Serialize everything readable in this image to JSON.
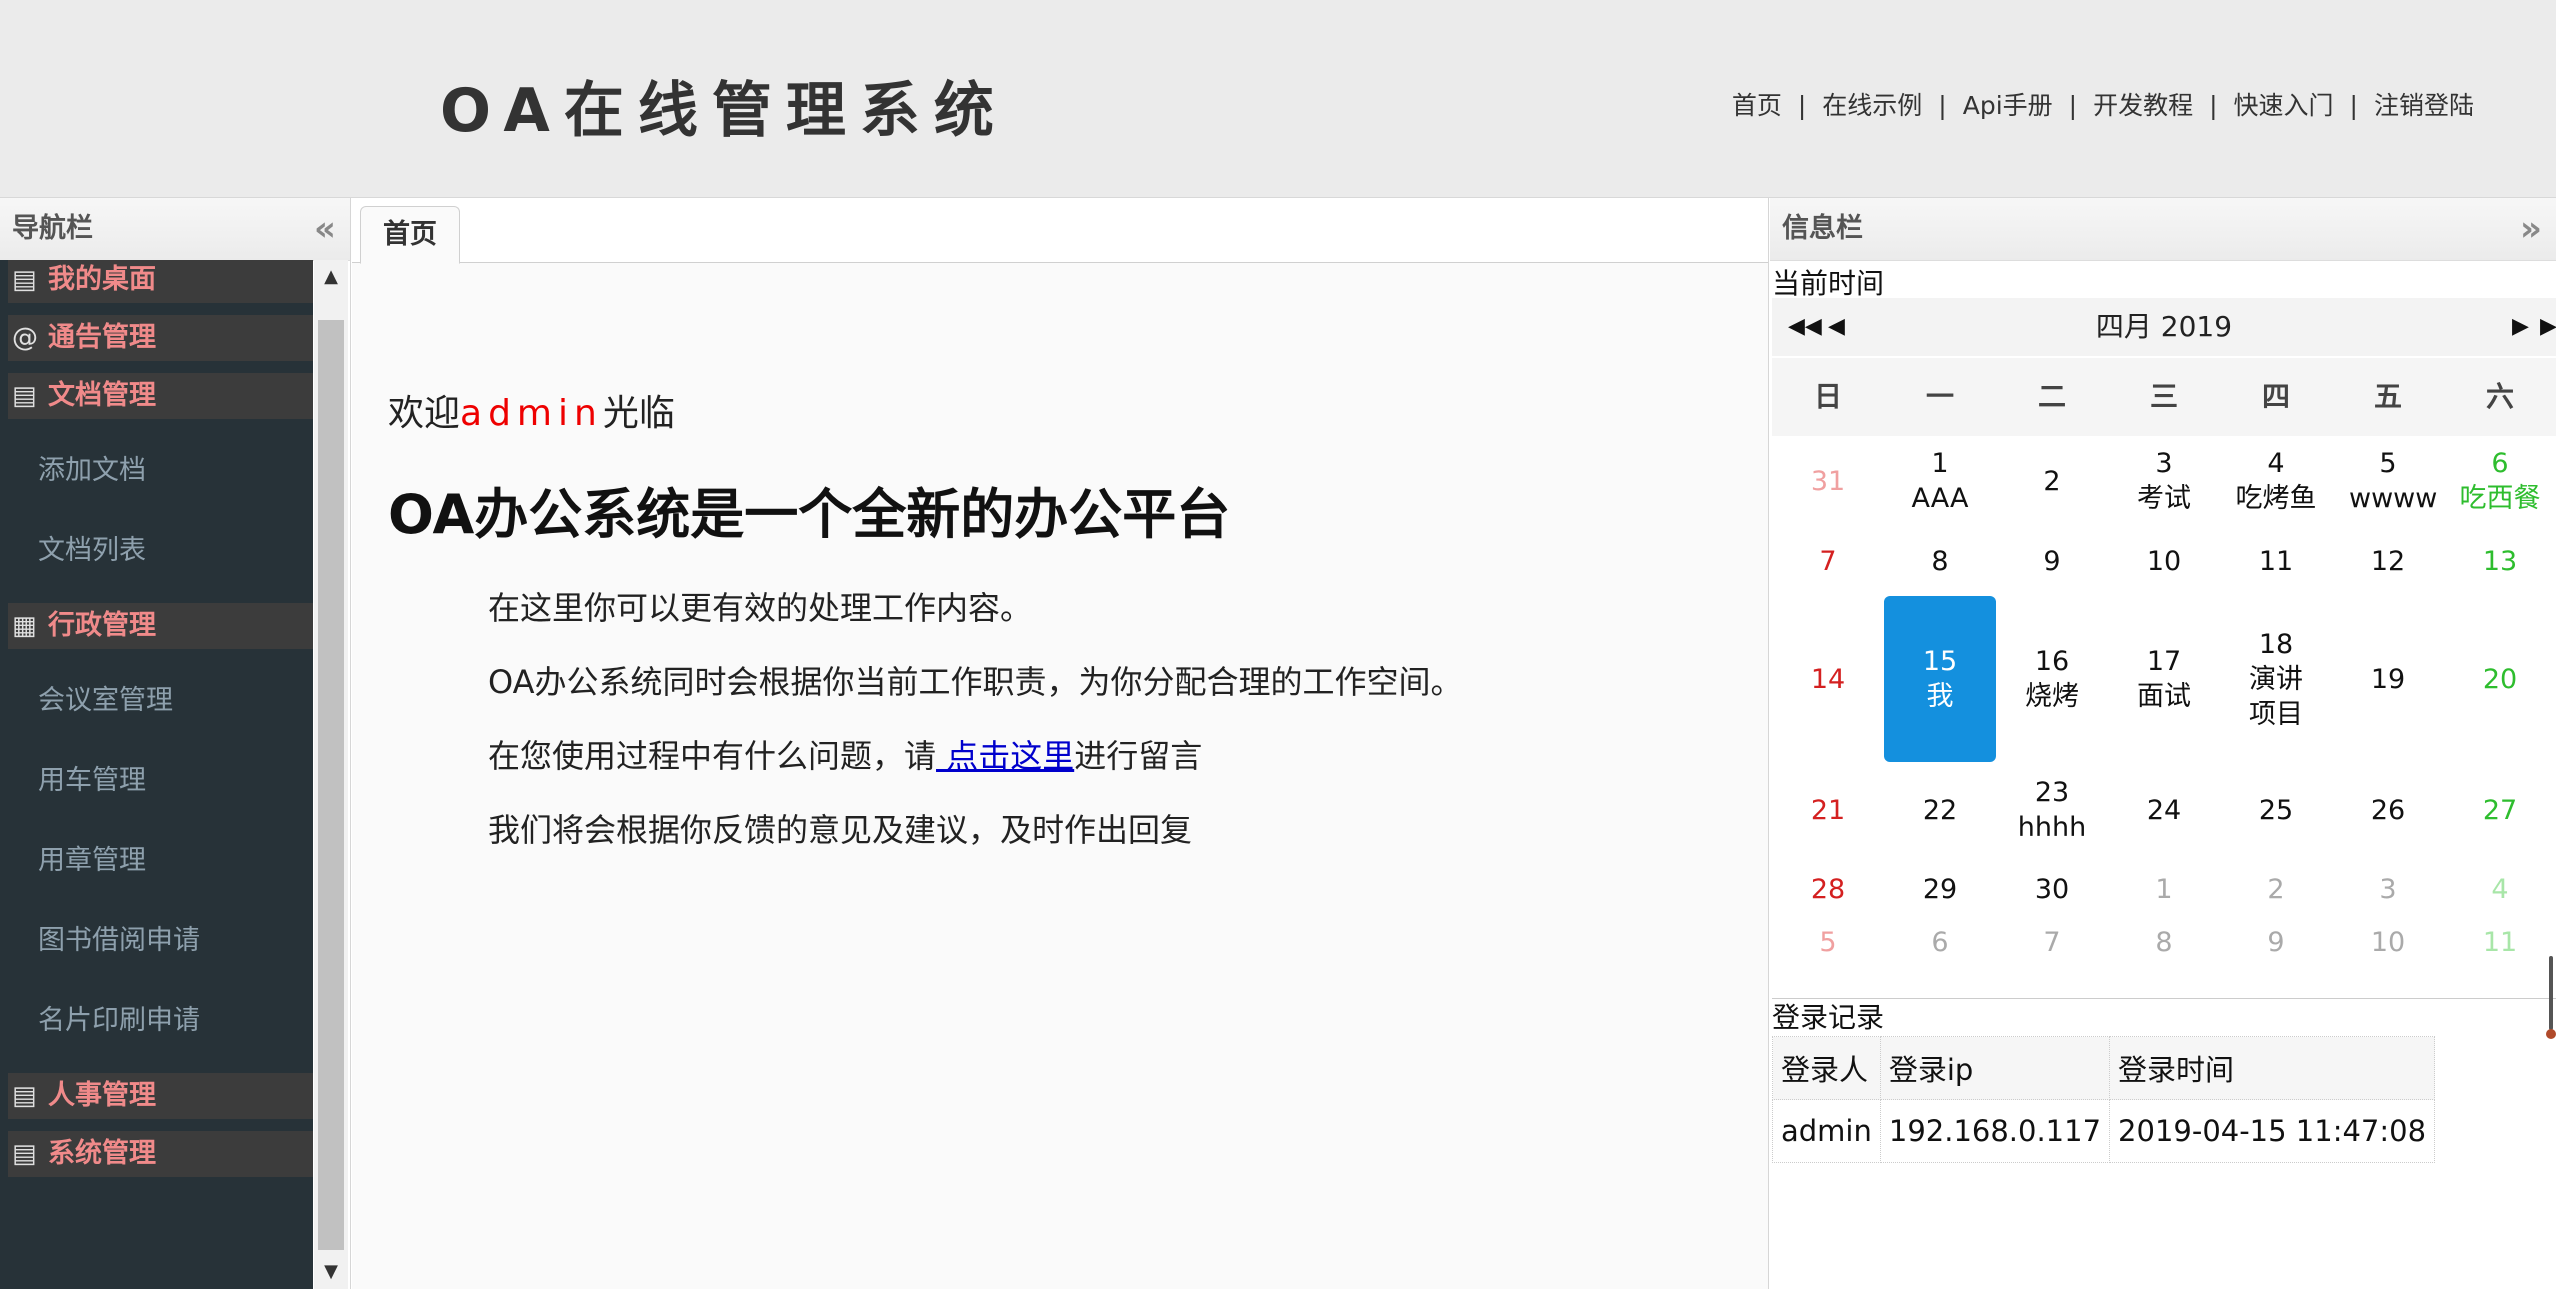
{
  "header": {
    "title": "OA在线管理系统",
    "nav": [
      "首页",
      "在线示例",
      "Api手册",
      "开发教程",
      "快速入门",
      "注销登陆"
    ],
    "separator": "|"
  },
  "nav_panel": {
    "title": "导航栏",
    "collapse_icon": "«",
    "groups": [
      {
        "label": "我的桌面",
        "icon": "memo-icon",
        "items": []
      },
      {
        "label": "通告管理",
        "icon": "at-icon",
        "items": []
      },
      {
        "label": "文档管理",
        "icon": "memo-icon",
        "items": [
          "添加文档",
          "文档列表"
        ]
      },
      {
        "label": "行政管理",
        "icon": "grid-icon",
        "items": [
          "会议室管理",
          "用车管理",
          "用章管理",
          "图书借阅申请",
          "名片印刷申请"
        ]
      },
      {
        "label": "人事管理",
        "icon": "memo-icon",
        "items": []
      },
      {
        "label": "系统管理",
        "icon": "memo-icon",
        "items": []
      }
    ]
  },
  "tabs": [
    {
      "label": "首页"
    }
  ],
  "main": {
    "welcome_prefix": "欢迎",
    "welcome_user": "admin",
    "welcome_suffix": "光临",
    "headline": "OA办公系统是一个全新的办公平台",
    "para1": "在这里你可以更有效的处理工作内容。",
    "para2": "OA办公系统同时会根据你当前工作职责，为你分配合理的工作空间。",
    "para3_prefix": "在您使用过程中有什么问题，请",
    "para3_link": " 点击这里",
    "para3_suffix": "进行留言",
    "para4": "我们将会根据你反馈的意见及建议，及时作出回复"
  },
  "info_panel": {
    "title": "信息栏",
    "expand_icon": "»",
    "current_time_label": "当前时间",
    "calendar": {
      "month_label": "四月 2019",
      "weekdays": [
        "日",
        "一",
        "二",
        "三",
        "四",
        "五",
        "六"
      ],
      "weeks": [
        [
          {
            "d": "31",
            "other": true
          },
          {
            "d": "1",
            "note": "AAA"
          },
          {
            "d": "2"
          },
          {
            "d": "3",
            "note": "考试"
          },
          {
            "d": "4",
            "note": "吃烤鱼"
          },
          {
            "d": "5",
            "note": "wwww"
          },
          {
            "d": "6",
            "note": "吃西餐"
          }
        ],
        [
          {
            "d": "7"
          },
          {
            "d": "8"
          },
          {
            "d": "9"
          },
          {
            "d": "10"
          },
          {
            "d": "11"
          },
          {
            "d": "12"
          },
          {
            "d": "13"
          }
        ],
        [
          {
            "d": "14"
          },
          {
            "d": "15",
            "note": "我",
            "today": true
          },
          {
            "d": "16",
            "note": "烧烤"
          },
          {
            "d": "17",
            "note": "面试"
          },
          {
            "d": "18",
            "note": "演讲项目"
          },
          {
            "d": "19"
          },
          {
            "d": "20"
          }
        ],
        [
          {
            "d": "21"
          },
          {
            "d": "22"
          },
          {
            "d": "23",
            "note": "hhhh"
          },
          {
            "d": "24"
          },
          {
            "d": "25"
          },
          {
            "d": "26"
          },
          {
            "d": "27"
          }
        ],
        [
          {
            "d": "28"
          },
          {
            "d": "29"
          },
          {
            "d": "30"
          },
          {
            "d": "1",
            "other": true
          },
          {
            "d": "2",
            "other": true
          },
          {
            "d": "3",
            "other": true
          },
          {
            "d": "4",
            "other": true
          }
        ],
        [
          {
            "d": "5",
            "other": true
          },
          {
            "d": "6",
            "other": true
          },
          {
            "d": "7",
            "other": true
          },
          {
            "d": "8",
            "other": true
          },
          {
            "d": "9",
            "other": true
          },
          {
            "d": "10",
            "other": true
          },
          {
            "d": "11",
            "other": true
          }
        ]
      ]
    },
    "login_records_label": "登录记录",
    "login_table": {
      "headers": [
        "登录人",
        "登录ip",
        "登录时间"
      ],
      "rows": [
        [
          "admin",
          "192.168.0.117",
          "2019-04-15 11:47:08"
        ]
      ]
    }
  },
  "colors": {
    "nav_bg": "#273238",
    "nav_group_bg": "#3c3c3c",
    "nav_group_text": "#f08a8a",
    "nav_item_text": "#8ea0ad",
    "today_bg": "#1490de",
    "sunday": "#d42020",
    "saturday": "#2ebd2e",
    "link": "#0000cc",
    "username": "#ee0000"
  }
}
